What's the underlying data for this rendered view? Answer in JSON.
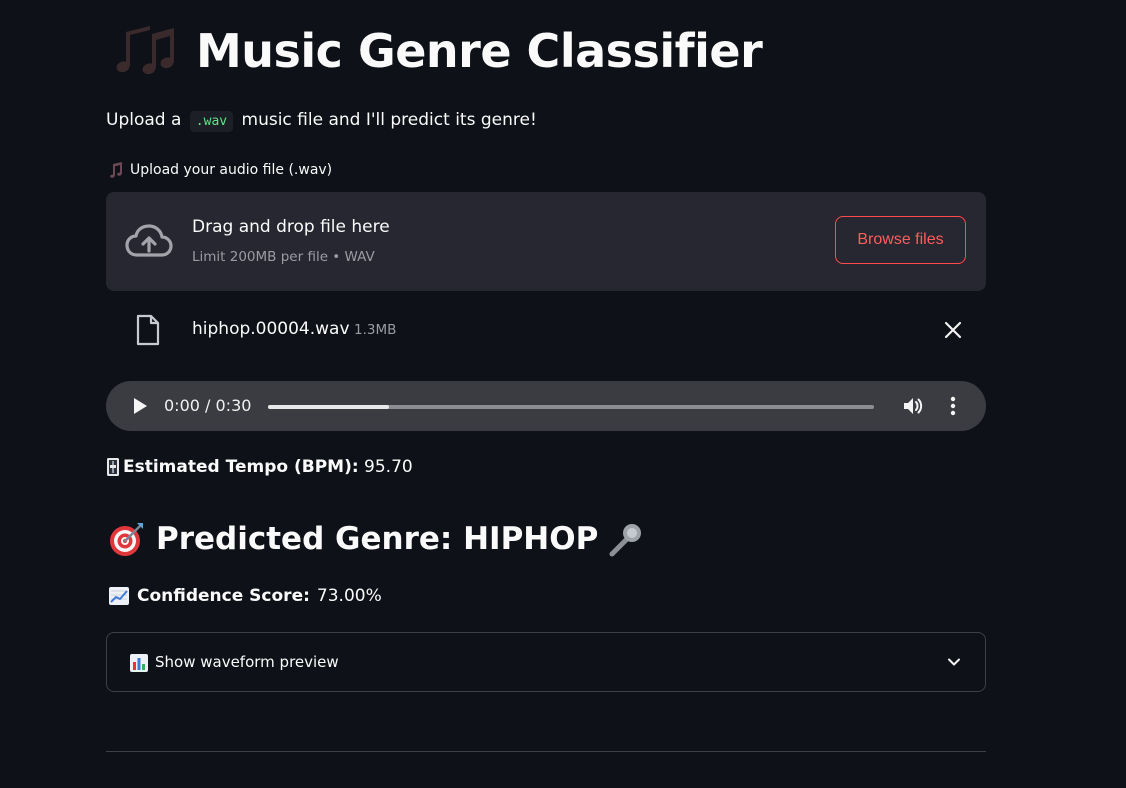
{
  "header": {
    "title": "Music Genre Classifier",
    "icon": "music-notes-icon"
  },
  "intro": {
    "prefix": "Upload a ",
    "code": ".wav",
    "suffix": " music file and I'll predict its genre!"
  },
  "uploader": {
    "label": "Upload your audio file (.wav)",
    "drop_title": "Drag and drop file here",
    "limit_text": "Limit 200MB per file • WAV",
    "browse_label": "Browse files"
  },
  "file": {
    "name": "hiphop.00004.wav",
    "size": "1.3MB"
  },
  "audio_player": {
    "time": "0:00 / 0:30",
    "progress": 0.2
  },
  "results": {
    "tempo_label": "Estimated Tempo (BPM):",
    "tempo_value": "95.70",
    "predicted": "Predicted Genre: HIPHOP",
    "confidence_label": "Confidence Score:",
    "confidence_value": "73.00%"
  },
  "expander": {
    "label": "Show waveform preview"
  },
  "colors": {
    "background": "#0e1117",
    "accent": "#ff4b4b",
    "code_text": "#5ce488"
  }
}
